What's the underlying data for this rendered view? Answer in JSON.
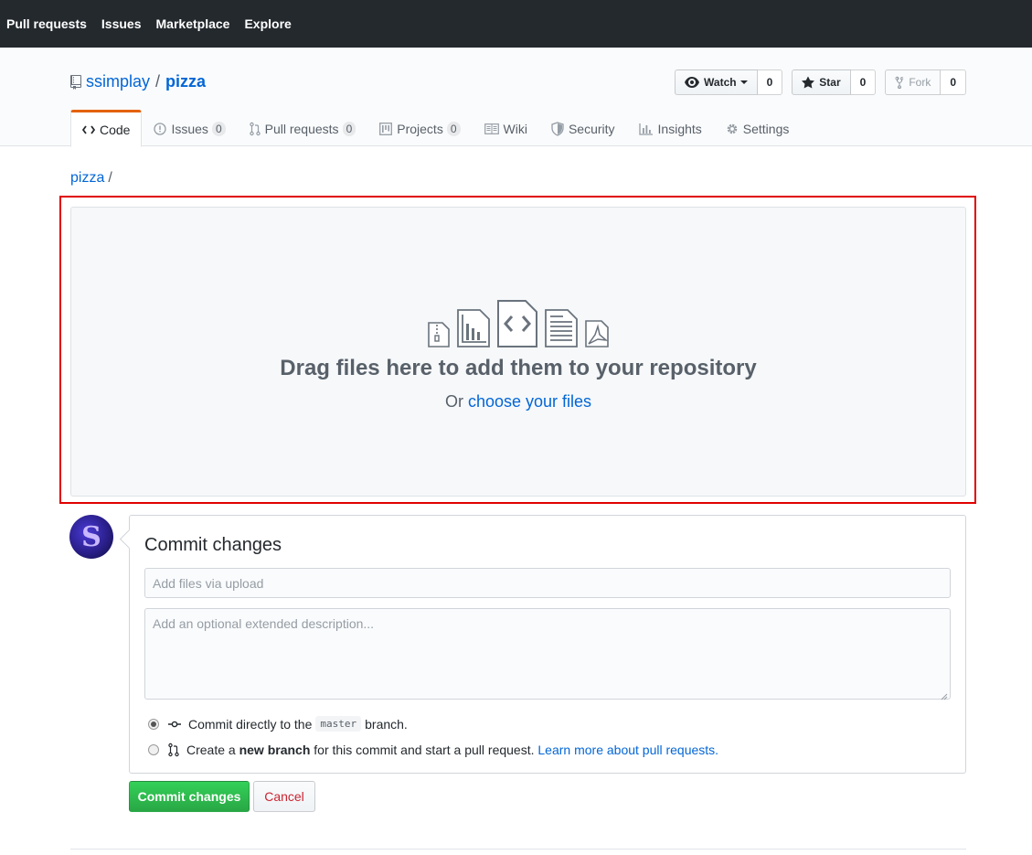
{
  "topnav": {
    "links": [
      "Pull requests",
      "Issues",
      "Marketplace",
      "Explore"
    ]
  },
  "repo": {
    "owner": "ssimplay",
    "separator": "/",
    "name": "pizza"
  },
  "actions": {
    "watch": {
      "label": "Watch",
      "count": "0"
    },
    "star": {
      "label": "Star",
      "count": "0"
    },
    "fork": {
      "label": "Fork",
      "count": "0"
    }
  },
  "tabs": {
    "code": {
      "label": "Code"
    },
    "issues": {
      "label": "Issues",
      "count": "0"
    },
    "pulls": {
      "label": "Pull requests",
      "count": "0"
    },
    "projects": {
      "label": "Projects",
      "count": "0"
    },
    "wiki": {
      "label": "Wiki"
    },
    "security": {
      "label": "Security"
    },
    "insights": {
      "label": "Insights"
    },
    "settings": {
      "label": "Settings"
    }
  },
  "breadcrumb": {
    "root": "pizza",
    "sep": "/"
  },
  "dropzone": {
    "title": "Drag files here to add them to your repository",
    "or": "Or",
    "choose_link": "choose your files",
    "highlight_color": "#e00000"
  },
  "commit": {
    "title": "Commit changes",
    "summary_placeholder": "Add files via upload",
    "description_placeholder": "Add an optional extended description...",
    "option_direct": {
      "before": "Commit directly to the",
      "branch": "master",
      "after": "branch."
    },
    "option_new": {
      "before": "Create a",
      "bold": "new branch",
      "after": "for this commit and start a pull request.",
      "link": "Learn more about pull requests."
    },
    "submit_label": "Commit changes",
    "cancel_label": "Cancel"
  },
  "avatar": {
    "letter": "S"
  }
}
